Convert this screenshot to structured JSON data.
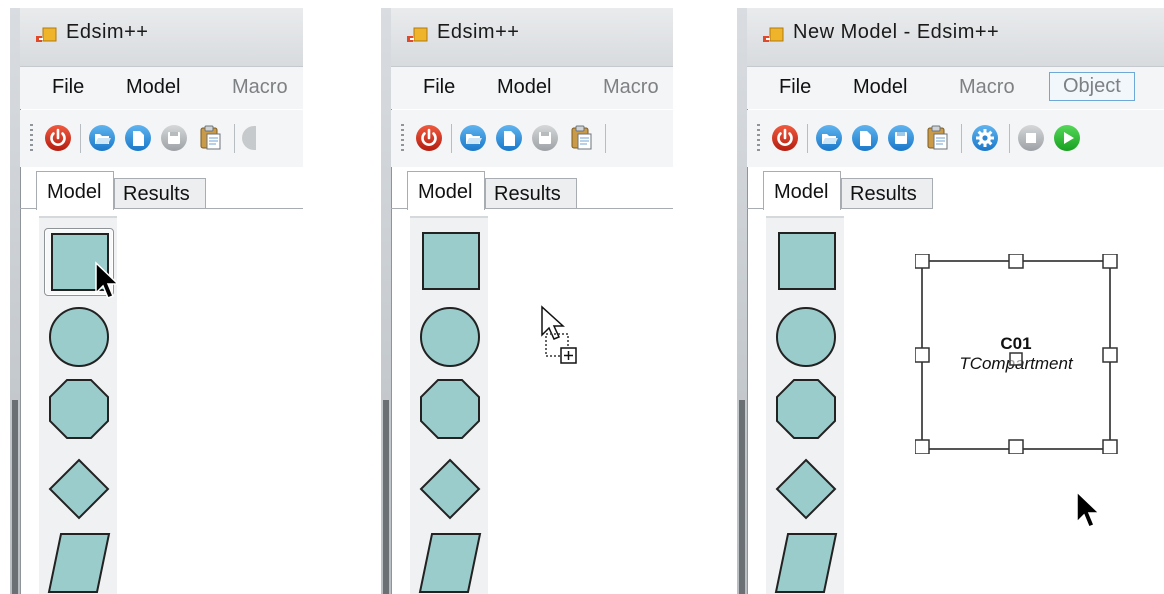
{
  "colors": {
    "shape_fill": "#9bcccc",
    "shape_stroke": "#222222",
    "focus_border": "#6fa7d6",
    "disabled_text": "#7e8184"
  },
  "panels": [
    {
      "title": "Edsim++",
      "menu": [
        {
          "label": "File",
          "enabled": true
        },
        {
          "label": "Model",
          "enabled": true
        },
        {
          "label": "Macro",
          "enabled": false
        }
      ],
      "toolbar": [
        "power-icon",
        "open-icon",
        "new-icon",
        "save-icon-disabled",
        "paste-icon"
      ],
      "tabs": [
        {
          "label": "Model",
          "active": true
        },
        {
          "label": "Results",
          "active": false
        }
      ],
      "palette": [
        "square",
        "circle",
        "octagon",
        "diamond",
        "parallelogram"
      ],
      "cursor": "arrow-pointer-on-square"
    },
    {
      "title": "Edsim++",
      "menu": [
        {
          "label": "File",
          "enabled": true
        },
        {
          "label": "Model",
          "enabled": true
        },
        {
          "label": "Macro",
          "enabled": false
        }
      ],
      "toolbar": [
        "power-icon",
        "open-icon",
        "new-icon",
        "save-icon-disabled",
        "paste-icon"
      ],
      "tabs": [
        {
          "label": "Model",
          "active": true
        },
        {
          "label": "Results",
          "active": false
        }
      ],
      "palette": [
        "square",
        "circle",
        "octagon",
        "diamond",
        "parallelogram"
      ],
      "cursor": "drag-copy-cursor"
    },
    {
      "title": "New Model - Edsim++",
      "menu": [
        {
          "label": "File",
          "enabled": true
        },
        {
          "label": "Model",
          "enabled": true
        },
        {
          "label": "Macro",
          "enabled": false
        },
        {
          "label": "Object",
          "enabled": false,
          "focused": true
        }
      ],
      "toolbar": [
        "power-icon",
        "open-icon",
        "new-icon",
        "save-icon",
        "paste-icon",
        "gear-icon",
        "stop-icon",
        "play-icon"
      ],
      "tabs": [
        {
          "label": "Model",
          "active": true
        },
        {
          "label": "Results",
          "active": false
        }
      ],
      "palette": [
        "square",
        "circle",
        "octagon",
        "diamond",
        "parallelogram"
      ],
      "canvas_node": {
        "name": "C01",
        "type": "TCompartment",
        "selected": true
      },
      "cursor": "arrow-pointer"
    }
  ]
}
